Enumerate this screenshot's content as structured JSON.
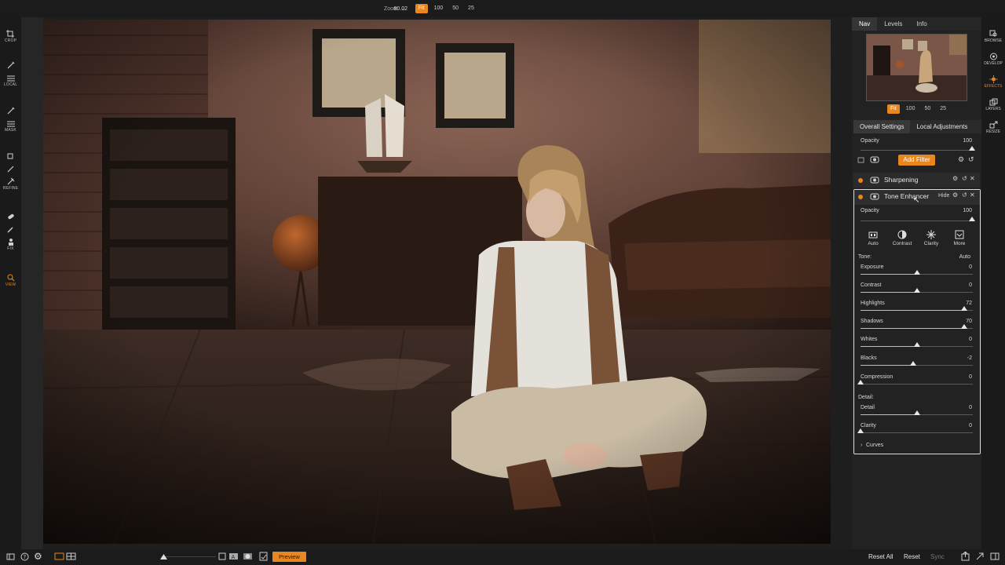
{
  "toolbar": {
    "zoom_label": "Zoom",
    "zoom_value": "80.02",
    "zoom_options": [
      "Fit",
      "100",
      "50",
      "25"
    ]
  },
  "left_tools": [
    {
      "label": "CROP",
      "icon": "crop-icon"
    },
    {
      "label": "LOCAL",
      "icon": "local-brush-icon"
    },
    {
      "label": "MASK",
      "icon": "mask-brush-icon"
    },
    {
      "label": "REFINE",
      "icon": "refine-icon"
    },
    {
      "label": "FIX",
      "icon": "fix-icon"
    },
    {
      "label": "VIEW",
      "icon": "view-icon"
    }
  ],
  "right_nav": [
    {
      "label": "BROWSE",
      "icon": "browse-icon"
    },
    {
      "label": "DEVELOP",
      "icon": "develop-icon"
    },
    {
      "label": "EFFECTS",
      "icon": "effects-icon",
      "active": true
    },
    {
      "label": "LAYERS",
      "icon": "layers-icon"
    },
    {
      "label": "RESIZE",
      "icon": "resize-icon"
    }
  ],
  "panel_tabs": [
    "Nav",
    "Levels",
    "Info"
  ],
  "thumb_zoom": [
    "Fit",
    "100",
    "50",
    "25"
  ],
  "settings_tabs": [
    "Overall Settings",
    "Local Adjustments"
  ],
  "overall": {
    "opacity_label": "Opacity",
    "opacity_value": "100",
    "opacity_fraction": 0.99,
    "add_filter": "Add Filter"
  },
  "filters": {
    "sharpening": "Sharpening",
    "tone": "Tone Enhancer",
    "hide": "Hide"
  },
  "tone": {
    "opacity_label": "Opacity",
    "opacity_value": "100",
    "presets": [
      "Auto",
      "Contrast",
      "Clarity",
      "More"
    ],
    "tone_label": "Tone:",
    "tone_auto": "Auto",
    "detail_label": "Detail:",
    "curves": "Curves",
    "sliders": [
      {
        "label": "Exposure",
        "value": "0",
        "fraction": 0.5
      },
      {
        "label": "Contrast",
        "value": "0",
        "fraction": 0.5
      },
      {
        "label": "Highlights",
        "value": "72",
        "fraction": 0.92
      },
      {
        "label": "Shadows",
        "value": "70",
        "fraction": 0.92
      },
      {
        "label": "Whites",
        "value": "0",
        "fraction": 0.5
      },
      {
        "label": "Blacks",
        "value": "-2",
        "fraction": 0.47
      },
      {
        "label": "Compression",
        "value": "0",
        "fraction": 0.0
      },
      {
        "label": "Detail",
        "value": "0",
        "fraction": 0.5
      },
      {
        "label": "Clarity",
        "value": "0",
        "fraction": 0.0
      }
    ]
  },
  "bottom": {
    "preview": "Preview",
    "reset_all": "Reset All",
    "reset": "Reset",
    "sync": "Sync"
  },
  "colors": {
    "accent": "#e8861f",
    "panel": "#222222",
    "background": "#1e1e1e"
  }
}
